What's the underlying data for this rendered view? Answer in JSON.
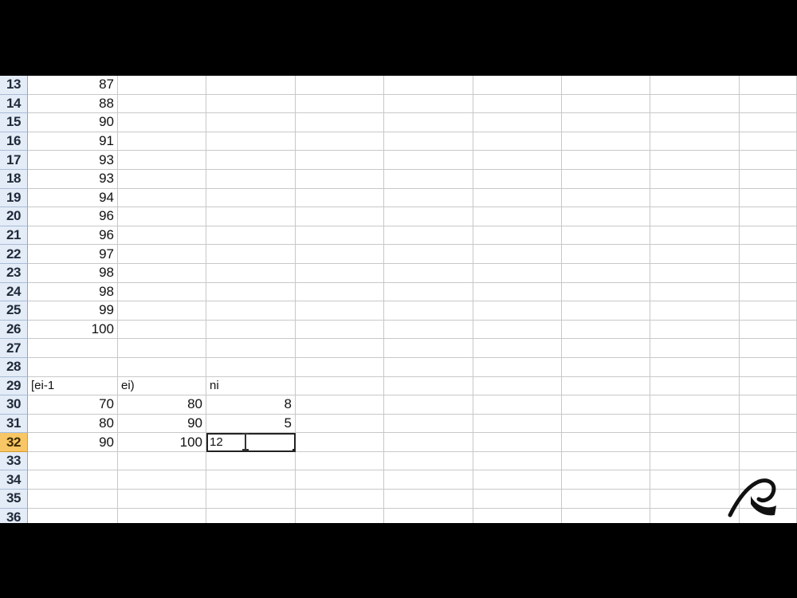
{
  "spreadsheet": {
    "rows": [
      {
        "num": "13",
        "cells": [
          "87",
          "",
          "",
          "",
          "",
          "",
          "",
          "",
          ""
        ]
      },
      {
        "num": "14",
        "cells": [
          "88",
          "",
          "",
          "",
          "",
          "",
          "",
          "",
          ""
        ]
      },
      {
        "num": "15",
        "cells": [
          "90",
          "",
          "",
          "",
          "",
          "",
          "",
          "",
          ""
        ]
      },
      {
        "num": "16",
        "cells": [
          "91",
          "",
          "",
          "",
          "",
          "",
          "",
          "",
          ""
        ]
      },
      {
        "num": "17",
        "cells": [
          "93",
          "",
          "",
          "",
          "",
          "",
          "",
          "",
          ""
        ]
      },
      {
        "num": "18",
        "cells": [
          "93",
          "",
          "",
          "",
          "",
          "",
          "",
          "",
          ""
        ]
      },
      {
        "num": "19",
        "cells": [
          "94",
          "",
          "",
          "",
          "",
          "",
          "",
          "",
          ""
        ]
      },
      {
        "num": "20",
        "cells": [
          "96",
          "",
          "",
          "",
          "",
          "",
          "",
          "",
          ""
        ]
      },
      {
        "num": "21",
        "cells": [
          "96",
          "",
          "",
          "",
          "",
          "",
          "",
          "",
          ""
        ]
      },
      {
        "num": "22",
        "cells": [
          "97",
          "",
          "",
          "",
          "",
          "",
          "",
          "",
          ""
        ]
      },
      {
        "num": "23",
        "cells": [
          "98",
          "",
          "",
          "",
          "",
          "",
          "",
          "",
          ""
        ]
      },
      {
        "num": "24",
        "cells": [
          "98",
          "",
          "",
          "",
          "",
          "",
          "",
          "",
          ""
        ]
      },
      {
        "num": "25",
        "cells": [
          "99",
          "",
          "",
          "",
          "",
          "",
          "",
          "",
          ""
        ]
      },
      {
        "num": "26",
        "cells": [
          "100",
          "",
          "",
          "",
          "",
          "",
          "",
          "",
          ""
        ]
      },
      {
        "num": "27",
        "cells": [
          "",
          "",
          "",
          "",
          "",
          "",
          "",
          "",
          ""
        ]
      },
      {
        "num": "28",
        "cells": [
          "",
          "",
          "",
          "",
          "",
          "",
          "",
          "",
          ""
        ]
      },
      {
        "num": "29",
        "cells": [
          "[ei-1",
          "ei)",
          "ni",
          "",
          "",
          "",
          "",
          "",
          ""
        ]
      },
      {
        "num": "30",
        "cells": [
          "70",
          "80",
          "8",
          "",
          "",
          "",
          "",
          "",
          ""
        ]
      },
      {
        "num": "31",
        "cells": [
          "80",
          "90",
          "5",
          "",
          "",
          "",
          "",
          "",
          ""
        ]
      },
      {
        "num": "32",
        "cells": [
          "90",
          "100",
          "12",
          "",
          "",
          "",
          "",
          "",
          ""
        ],
        "active": true
      },
      {
        "num": "33",
        "cells": [
          "",
          "",
          "",
          "",
          "",
          "",
          "",
          "",
          ""
        ]
      },
      {
        "num": "34",
        "cells": [
          "",
          "",
          "",
          "",
          "",
          "",
          "",
          "",
          ""
        ]
      },
      {
        "num": "35",
        "cells": [
          "",
          "",
          "",
          "",
          "",
          "",
          "",
          "",
          ""
        ]
      },
      {
        "num": "36",
        "cells": [
          "",
          "",
          "",
          "",
          "",
          "",
          "",
          "",
          ""
        ]
      }
    ],
    "text_cells": [
      "[ei-1",
      "ei)",
      "ni"
    ],
    "selected_cell": {
      "row": "32",
      "col": 2
    },
    "colors": {
      "row_header_bg": "#e4ecf7",
      "active_row_header_bg": "#f8c664",
      "gridline": "#c8c8c8",
      "background": "#000000"
    },
    "icons": [
      "ibeam-cursor-icon",
      "brand-logo-icon",
      "fill-handle-icon"
    ]
  }
}
